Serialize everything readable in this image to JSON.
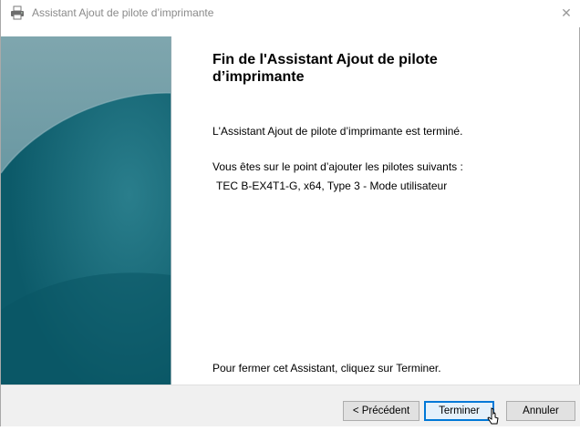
{
  "window": {
    "title": "Assistant Ajout de pilote d’imprimante",
    "title_icon": "printer-icon",
    "close_glyph": "✕"
  },
  "content": {
    "heading": "Fin de l'Assistant Ajout de pilote d’imprimante",
    "completed_text": "L'Assistant Ajout de pilote d’imprimante est terminé.",
    "intro_text": "Vous êtes sur le point d’ajouter les pilotes suivants :",
    "driver_entry": "TEC B-EX4T1-G, x64, Type 3 - Mode utilisateur",
    "close_instruction": "Pour fermer cet Assistant, cliquez sur Terminer."
  },
  "buttons": {
    "back": "< Précédent",
    "finish": "Terminer",
    "cancel": "Annuler"
  },
  "colors": {
    "accent": "#0078d7",
    "banner": "#1f6f7e"
  }
}
